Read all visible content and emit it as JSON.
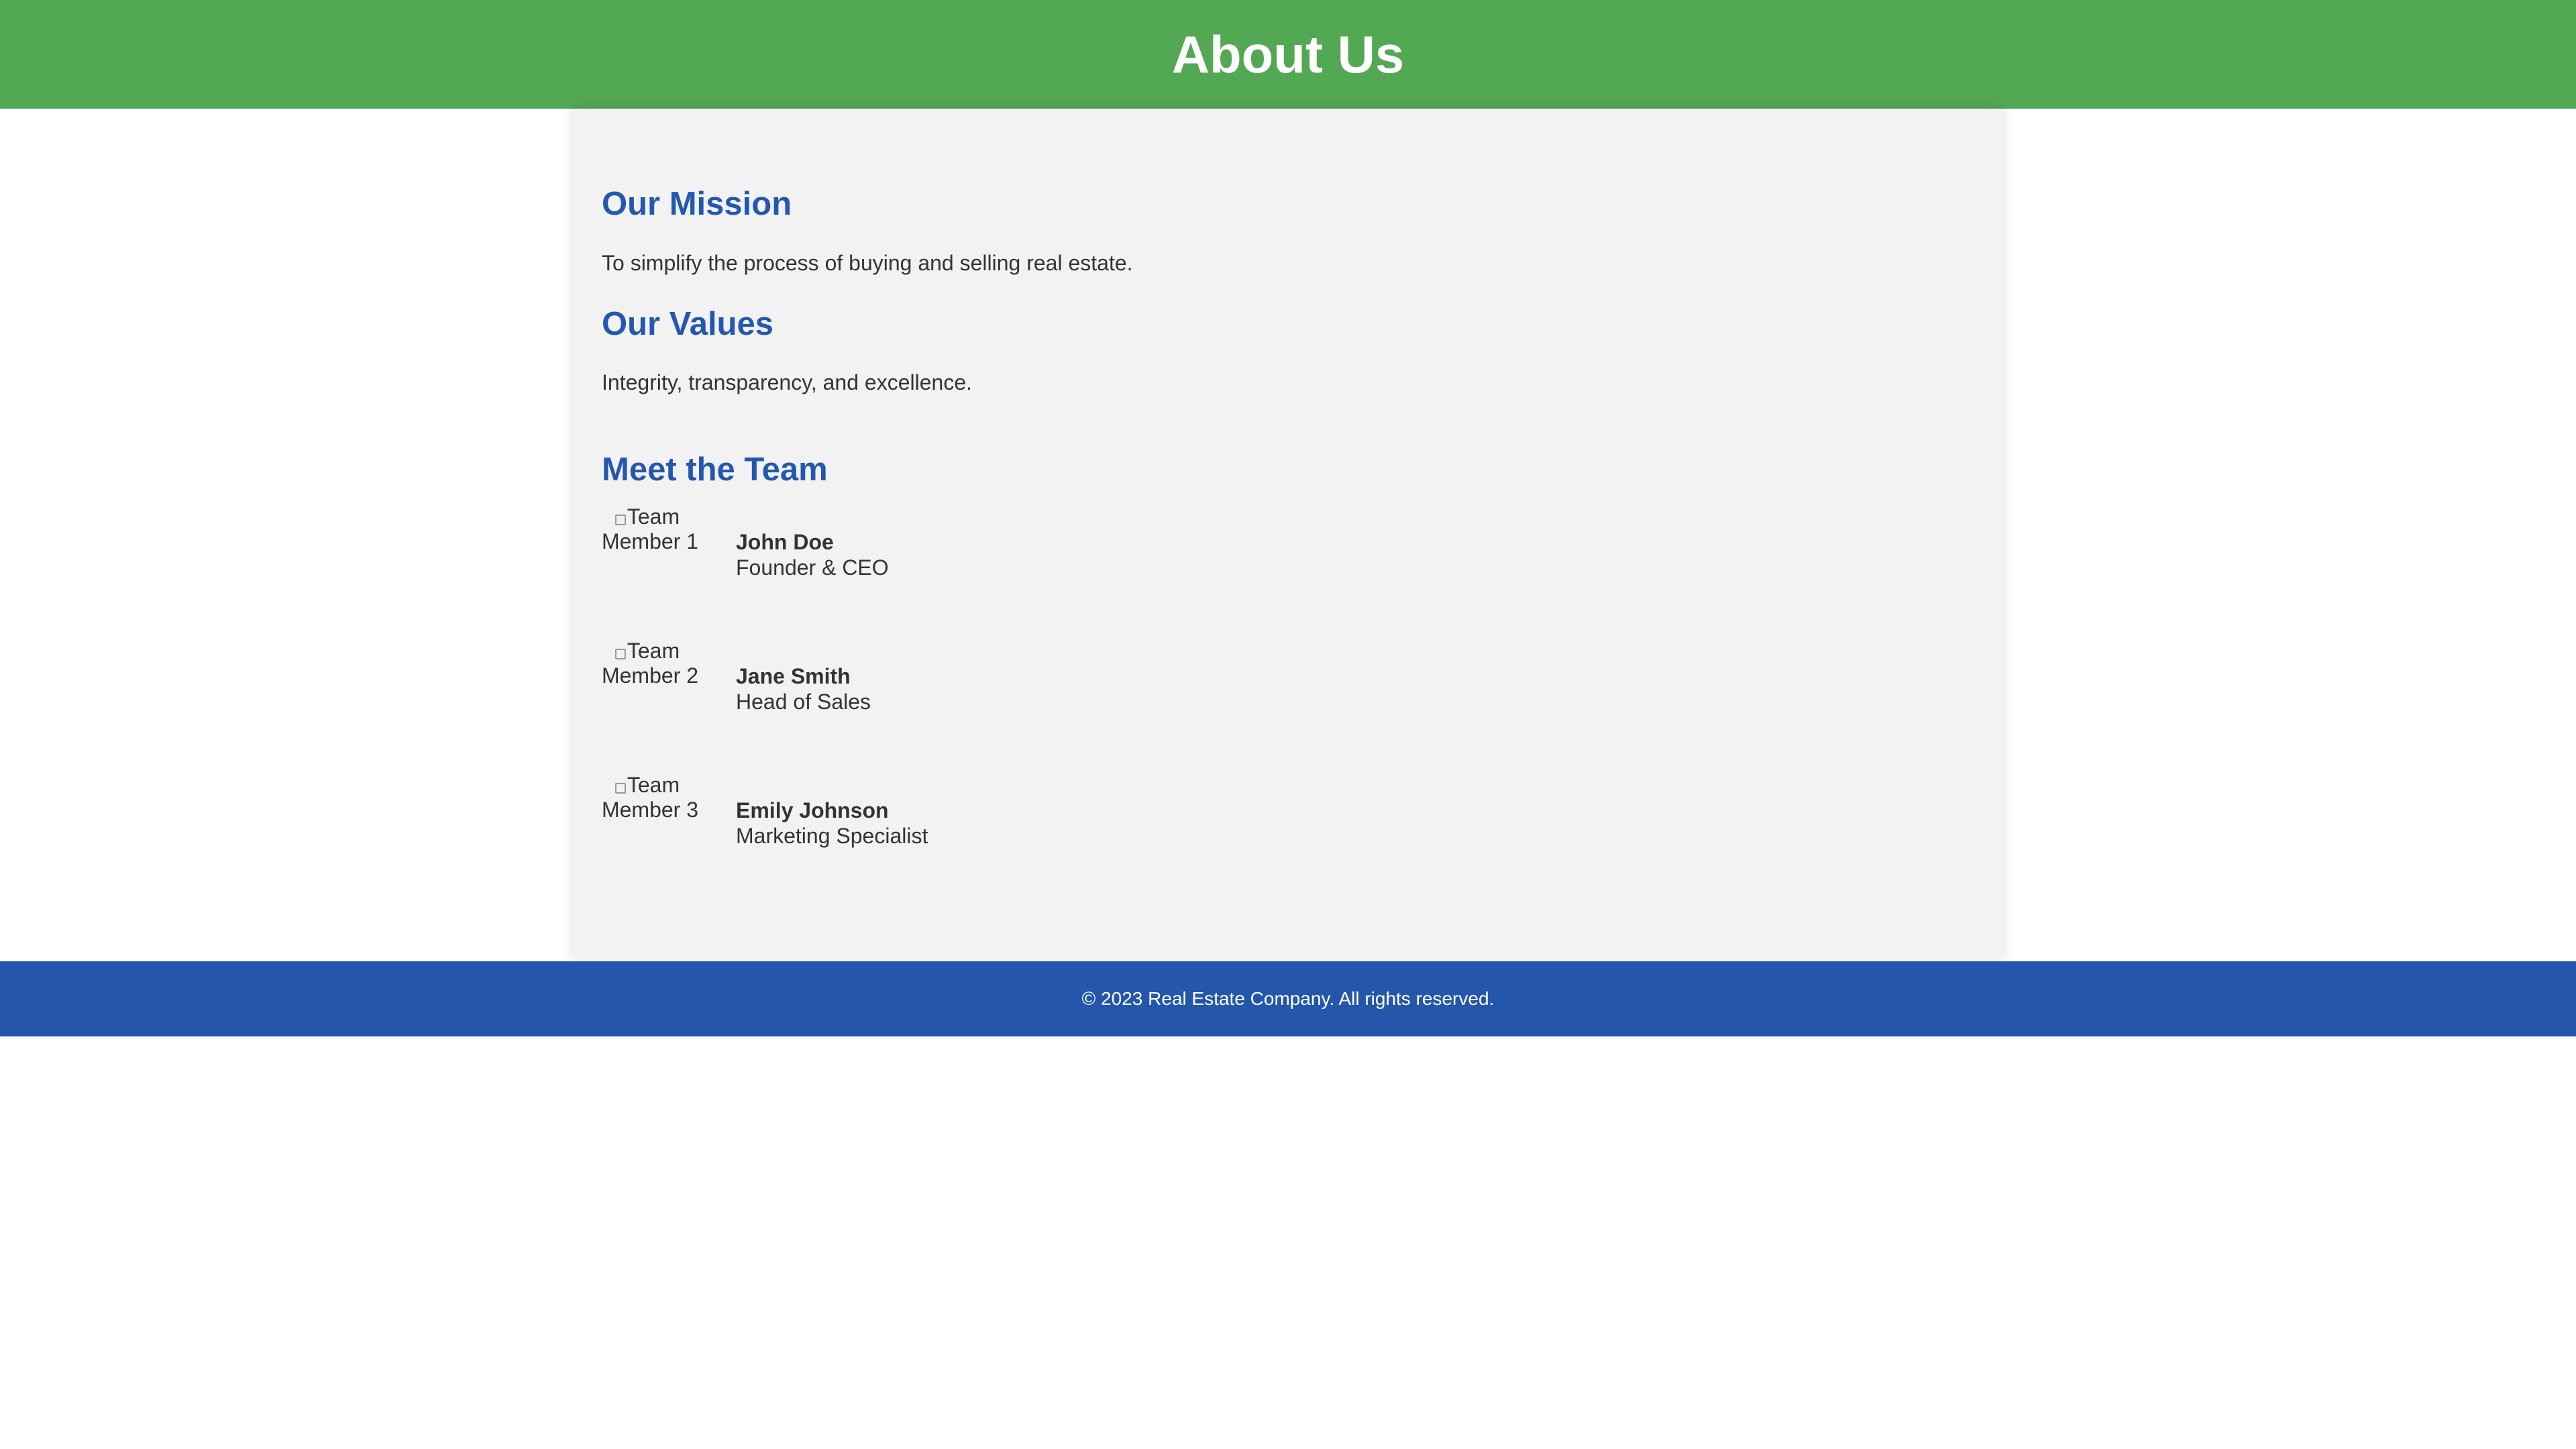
{
  "header": {
    "title": "About Us"
  },
  "sections": {
    "mission": {
      "heading": "Our Mission",
      "text": "To simplify the process of buying and selling real estate."
    },
    "values": {
      "heading": "Our Values",
      "text": "Integrity, transparency, and excellence."
    },
    "team": {
      "heading": "Meet the Team",
      "members": [
        {
          "image_alt": "Team Member 1",
          "name": "John Doe",
          "role": "Founder & CEO"
        },
        {
          "image_alt": "Team Member 2",
          "name": "Jane Smith",
          "role": "Head of Sales"
        },
        {
          "image_alt": "Team Member 3",
          "name": "Emily Johnson",
          "role": "Marketing Specialist"
        }
      ]
    }
  },
  "footer": {
    "text": "© 2023 Real Estate Company. All rights reserved."
  },
  "colors": {
    "header_bg": "#53a853",
    "heading": "#2458b0",
    "panel_bg": "#f2f2f2",
    "footer_bg": "#2456ac"
  }
}
